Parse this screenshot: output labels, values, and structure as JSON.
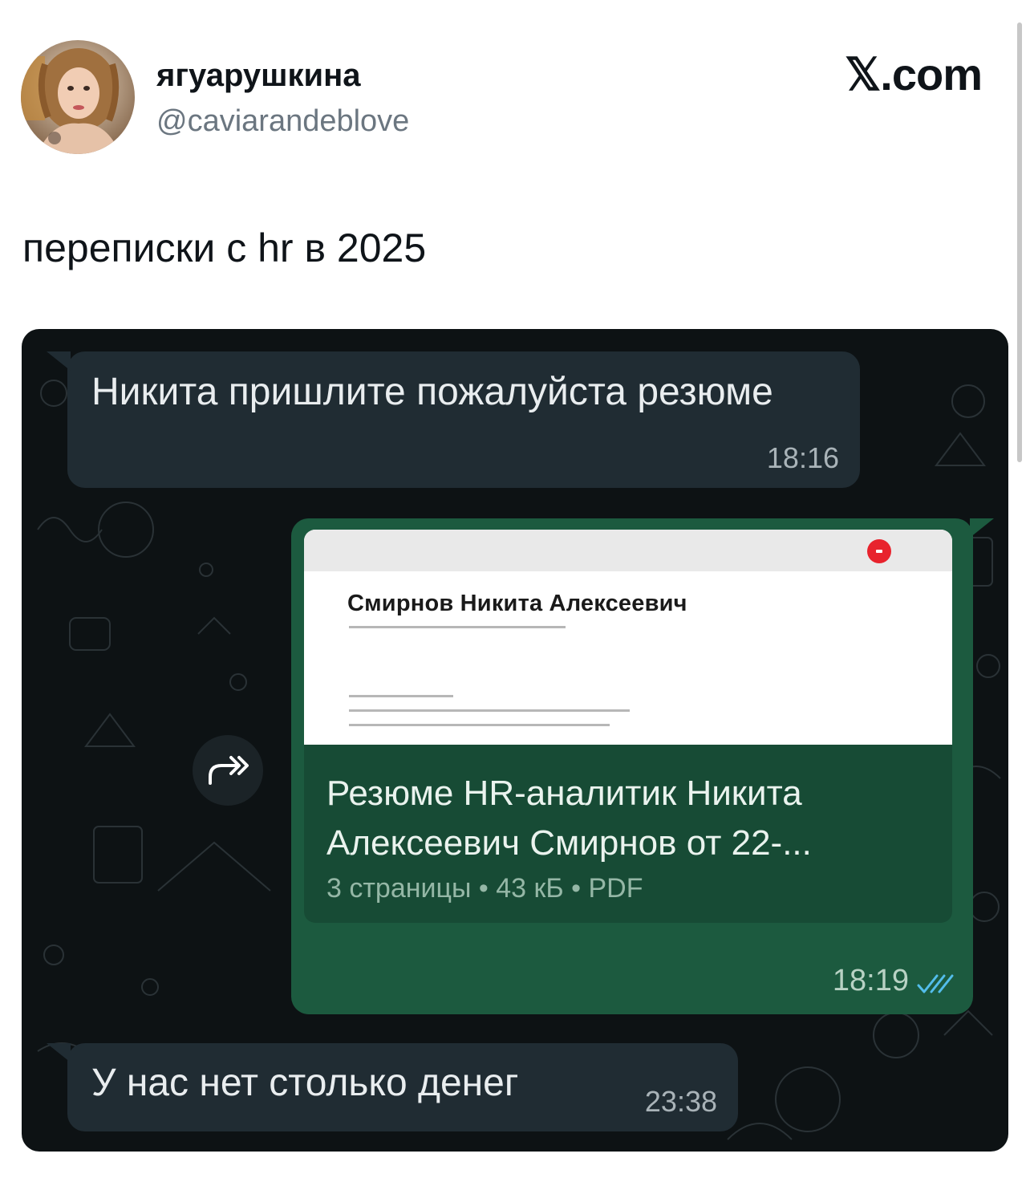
{
  "post": {
    "author_name": "ягуарушкина",
    "author_handle": "@caviarandeblove",
    "site_label": "𝕏.com",
    "text": "переписки с hr в 2025"
  },
  "chat": {
    "message1": {
      "text": "Никита пришлите пожалуйста резюме",
      "time": "18:16"
    },
    "document_message": {
      "preview_name": "Смирнов Никита Алексеевич",
      "title": "Резюме HR-аналитик Никита Алексеевич Смирнов от 22-...",
      "meta": "3 страницы • 43 кБ • PDF",
      "time": "18:19",
      "status": "read-double-check-icon"
    },
    "message2": {
      "text": "У нас нет столько денег",
      "time": "23:38"
    }
  },
  "colors": {
    "chat_background": "#0d1214",
    "incoming_bubble": "#202c33",
    "outgoing_bubble": "#1c5a3f",
    "read_ticks": "#53bdeb"
  }
}
